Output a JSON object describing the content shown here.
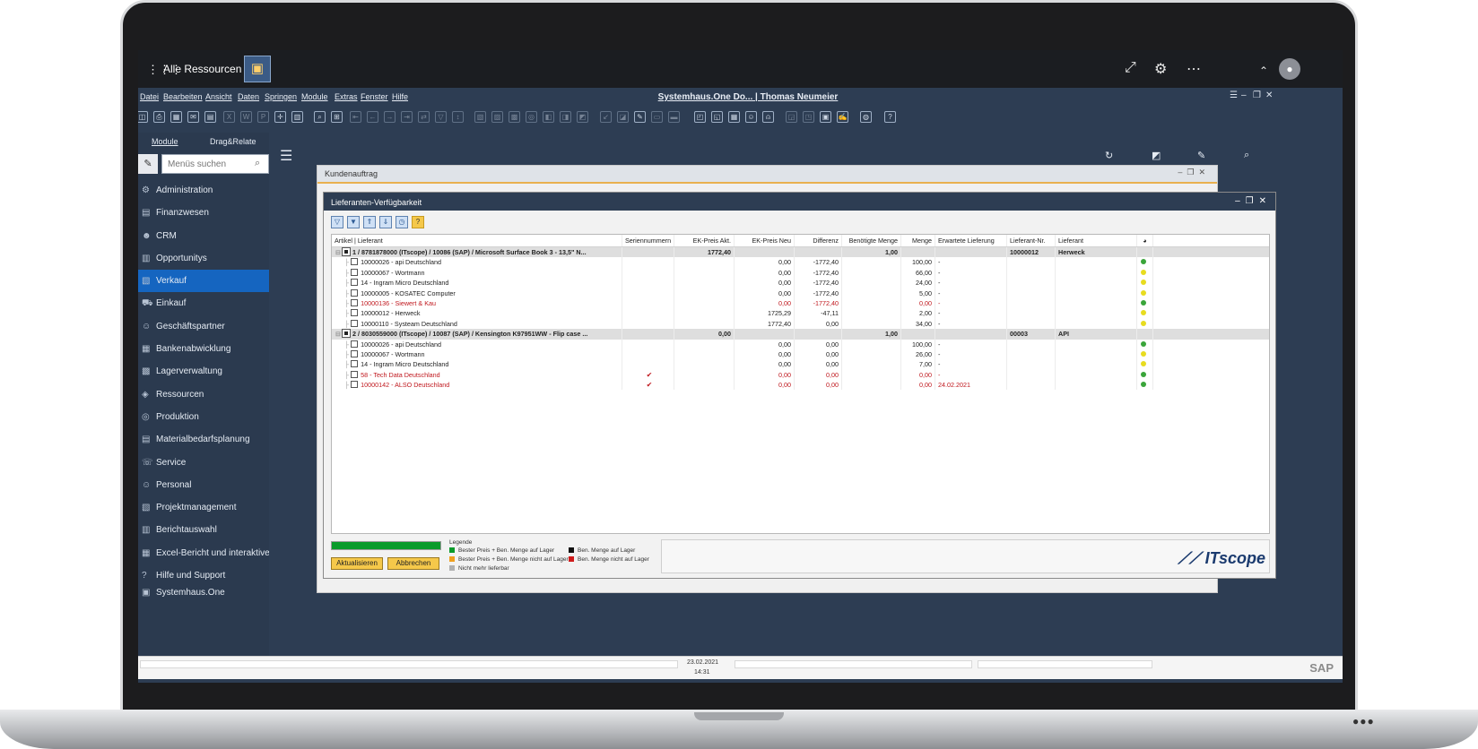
{
  "topbar": {
    "label": "Alle Ressourcen"
  },
  "menu": {
    "items": [
      "Datei",
      "Bearbeiten",
      "Ansicht",
      "Daten",
      "Springen",
      "Module",
      "Extras",
      "Fenster",
      "Hilfe"
    ],
    "title": "Systemhaus.One Do... | Thomas Neumeier"
  },
  "sidebar": {
    "tabs": [
      "Module",
      "Drag&Relate"
    ],
    "search_placeholder": "Menüs suchen",
    "items": [
      "Administration",
      "Finanzwesen",
      "CRM",
      "Opportunitys",
      "Verkauf",
      "Einkauf",
      "Geschäftspartner",
      "Bankenabwicklung",
      "Lagerverwaltung",
      "Ressourcen",
      "Produktion",
      "Materialbedarfsplanung",
      "Service",
      "Personal",
      "Projektmanagement",
      "Berichtauswahl",
      "Excel-Bericht und interaktive",
      "Hilfe und Support",
      "Systemhaus.One"
    ],
    "active": "Verkauf"
  },
  "backwin": {
    "title": "Kundenauftrag"
  },
  "window": {
    "title": "Lieferanten-Verfügbarkeit",
    "columns": [
      "Artikel | Lieferant",
      "Seriennummern",
      "EK-Preis Akt.",
      "EK-Preis Neu",
      "Differenz",
      "Benötigte Menge",
      "Menge",
      "Erwartete Lieferung",
      "Lieferant-Nr.",
      "Lieferant"
    ],
    "rows": [
      {
        "type": "group",
        "article": "1 / 8781878000 (ITscope) / 10086 (SAP) / Microsoft Surface Book 3 - 13,5\" N...",
        "serial": "",
        "ek_akt": "1772,40",
        "ek_neu": "",
        "diff": "",
        "ben_menge": "1,00",
        "menge": "",
        "lieferung": "",
        "lief_nr": "10000012",
        "lieferant": "Herweck",
        "status": ""
      },
      {
        "type": "item",
        "article": "10000026 - api Deutschland",
        "serial": "",
        "ek_akt": "",
        "ek_neu": "0,00",
        "diff": "-1772,40",
        "ben_menge": "",
        "menge": "100,00",
        "lieferung": "-",
        "lief_nr": "",
        "lieferant": "",
        "status": "#3aa53a"
      },
      {
        "type": "item",
        "article": "10000067 - Wortmann",
        "serial": "",
        "ek_akt": "",
        "ek_neu": "0,00",
        "diff": "-1772,40",
        "ben_menge": "",
        "menge": "66,00",
        "lieferung": "-",
        "lief_nr": "",
        "lieferant": "",
        "status": "#e8dc1f"
      },
      {
        "type": "item",
        "article": "14 - Ingram Micro Deutschland",
        "serial": "",
        "ek_akt": "",
        "ek_neu": "0,00",
        "diff": "-1772,40",
        "ben_menge": "",
        "menge": "24,00",
        "lieferung": "-",
        "lief_nr": "",
        "lieferant": "",
        "status": "#e8dc1f"
      },
      {
        "type": "item",
        "article": "10000005 - KOSATEC Computer",
        "serial": "",
        "ek_akt": "",
        "ek_neu": "0,00",
        "diff": "-1772,40",
        "ben_menge": "",
        "menge": "5,00",
        "lieferung": "-",
        "lief_nr": "",
        "lieferant": "",
        "status": "#e8dc1f"
      },
      {
        "type": "red",
        "article": "10000136 - Siewert & Kau",
        "serial": "",
        "ek_akt": "",
        "ek_neu": "0,00",
        "diff": "-1772,40",
        "ben_menge": "",
        "menge": "0,00",
        "lieferung": "-",
        "lief_nr": "",
        "lieferant": "",
        "status": "#3aa53a"
      },
      {
        "type": "item",
        "article": "10000012 - Herweck",
        "serial": "",
        "ek_akt": "",
        "ek_neu": "1725,29",
        "diff": "-47,11",
        "ben_menge": "",
        "menge": "2,00",
        "lieferung": "-",
        "lief_nr": "",
        "lieferant": "",
        "status": "#e8dc1f"
      },
      {
        "type": "item",
        "article": "10000110 - Systeam Deutschland",
        "serial": "",
        "ek_akt": "",
        "ek_neu": "1772,40",
        "diff": "0,00",
        "ben_menge": "",
        "menge": "34,00",
        "lieferung": "-",
        "lief_nr": "",
        "lieferant": "",
        "status": "#e8dc1f"
      },
      {
        "type": "group",
        "article": "2 / 8030559000 (ITscope) / 10087 (SAP) / Kensington K97951WW - Flip case ...",
        "serial": "",
        "ek_akt": "0,00",
        "ek_neu": "",
        "diff": "",
        "ben_menge": "1,00",
        "menge": "",
        "lieferung": "",
        "lief_nr": "00003",
        "lieferant": "API",
        "status": ""
      },
      {
        "type": "item",
        "article": "10000026 - api Deutschland",
        "serial": "",
        "ek_akt": "",
        "ek_neu": "0,00",
        "diff": "0,00",
        "ben_menge": "",
        "menge": "100,00",
        "lieferung": "-",
        "lief_nr": "",
        "lieferant": "",
        "status": "#3aa53a"
      },
      {
        "type": "item",
        "article": "10000067 - Wortmann",
        "serial": "",
        "ek_akt": "",
        "ek_neu": "0,00",
        "diff": "0,00",
        "ben_menge": "",
        "menge": "26,00",
        "lieferung": "-",
        "lief_nr": "",
        "lieferant": "",
        "status": "#e8dc1f"
      },
      {
        "type": "item",
        "article": "14 - Ingram Micro Deutschland",
        "serial": "",
        "ek_akt": "",
        "ek_neu": "0,00",
        "diff": "0,00",
        "ben_menge": "",
        "menge": "7,00",
        "lieferung": "-",
        "lief_nr": "",
        "lieferant": "",
        "status": "#e8dc1f"
      },
      {
        "type": "red",
        "article": "58 - Tech Data Deutschland",
        "serial": "✔",
        "ek_akt": "",
        "ek_neu": "0,00",
        "diff": "0,00",
        "ben_menge": "",
        "menge": "0,00",
        "lieferung": "-",
        "lief_nr": "",
        "lieferant": "",
        "status": "#3aa53a"
      },
      {
        "type": "red",
        "article": "10000142 - ALSO Deutschland",
        "serial": "✔",
        "ek_akt": "",
        "ek_neu": "0,00",
        "diff": "0,00",
        "ben_menge": "",
        "menge": "0,00",
        "lieferung": "24.02.2021",
        "lief_nr": "",
        "lieferant": "",
        "status": "#3aa53a"
      }
    ],
    "legend": {
      "title": "Legende",
      "items": [
        {
          "label": "Bester Preis + Ben. Menge auf Lager",
          "color": "#0a9b2b"
        },
        {
          "label": "Bester Preis + Ben. Menge nicht auf Lager",
          "color": "#f0a020"
        },
        {
          "label": "Nicht mehr lieferbar",
          "color": "#b0b0b0"
        },
        {
          "label": "Ben. Menge auf Lager",
          "color": "#111111"
        },
        {
          "label": "Ben. Menge nicht auf Lager",
          "color": "#d01c1c"
        }
      ]
    },
    "buttons": {
      "refresh": "Aktualisieren",
      "cancel": "Abbrechen"
    },
    "logo": "ITscope"
  },
  "statusbar": {
    "date": "23.02.2021",
    "time": "14:31",
    "brand": "SAP"
  }
}
